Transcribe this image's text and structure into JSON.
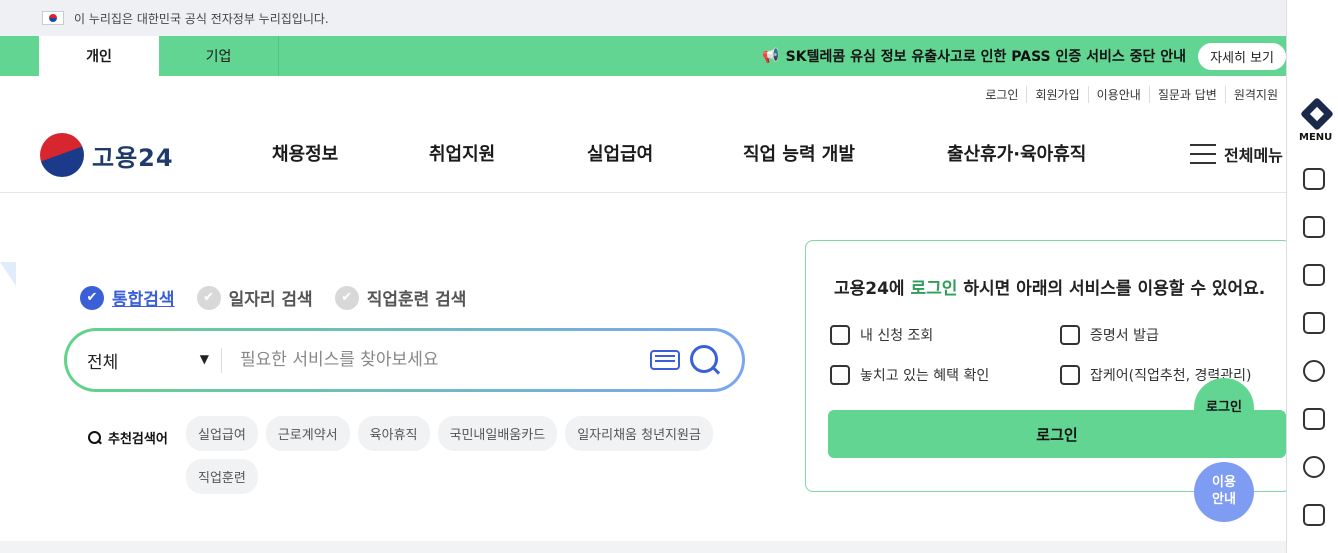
{
  "gov_banner": {
    "text": "이 누리집은 대한민국 공식 전자정부 누리집입니다."
  },
  "tabs": [
    {
      "label": "개인"
    },
    {
      "label": "기업"
    }
  ],
  "notice": {
    "text": "SK텔레콤 유심 정보 유출사고로 인한 PASS 인증 서비스 중단 안내",
    "button": "자세히 보기"
  },
  "util_links": [
    "로그인",
    "회원가입",
    "이용안내",
    "질문과 답변",
    "원격지원"
  ],
  "logo": {
    "text": "고용24"
  },
  "gnb": [
    "채용정보",
    "취업지원",
    "실업급여",
    "직업 능력 개발",
    "출산휴가·육아휴직"
  ],
  "all_menu": "전체메뉴",
  "search": {
    "types": [
      "통합검색",
      "일자리 검색",
      "직업훈련 검색"
    ],
    "category": "전체",
    "placeholder": "필요한 서비스를 찾아보세요"
  },
  "recommend": {
    "title": "추천검색어",
    "keywords": [
      "실업급여",
      "근로계약서",
      "육아휴직",
      "국민내일배움카드",
      "일자리채움 청년지원금",
      "직업훈련"
    ]
  },
  "login_panel": {
    "title_pre": "고용24에 ",
    "title_hl": "로그인",
    "title_post": " 하시면 아래의 서비스를 이용할 수 있어요.",
    "services": [
      "내 신청 조회",
      "증명서 발급",
      "놓치고 있는 혜택 확인",
      "잡케어(직업추천, 경력관리)"
    ],
    "button": "로그인"
  },
  "floating": {
    "login": "로그인",
    "guide_line1": "이용",
    "guide_line2": "안내"
  },
  "quick_menu": {
    "label": "MENU"
  }
}
